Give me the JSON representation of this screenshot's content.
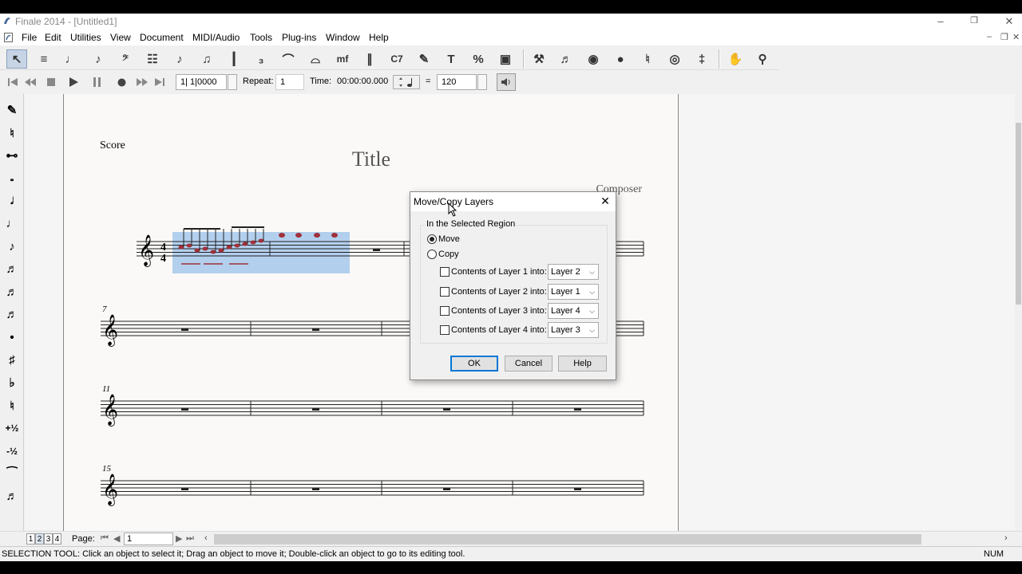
{
  "window": {
    "title": "Finale 2014 - [Untitled1]",
    "minimize": "–",
    "restore": "❐",
    "close": "✕"
  },
  "menu": {
    "items": [
      "File",
      "Edit",
      "Utilities",
      "View",
      "Document",
      "MIDI/Audio",
      "Tools",
      "Plug-ins",
      "Window",
      "Help"
    ],
    "mdi_min": "–",
    "mdi_restore": "❐",
    "mdi_close": "✕"
  },
  "toolbar": {
    "tools": [
      {
        "name": "selection-tool",
        "glyph": "↖"
      },
      {
        "name": "staff-tool",
        "glyph": "≡"
      },
      {
        "name": "simple-entry-tool",
        "glyph": "♩"
      },
      {
        "name": "speedy-entry-tool",
        "glyph": "♪"
      },
      {
        "name": "clef-tool",
        "glyph": "𝄢"
      },
      {
        "name": "key-signature-tool",
        "glyph": "☷"
      },
      {
        "name": "time-signature-tool",
        "glyph": "♪"
      },
      {
        "name": "note-mover-tool",
        "glyph": "♫"
      },
      {
        "name": "measure-tool",
        "glyph": "┃"
      },
      {
        "name": "tuplet-tool",
        "glyph": "₃"
      },
      {
        "name": "smart-shape-tool",
        "glyph": "⌒"
      },
      {
        "name": "articulation-tool",
        "glyph": "⌓"
      },
      {
        "name": "expression-tool",
        "glyph": "mf"
      },
      {
        "name": "repeat-tool",
        "glyph": "∥"
      },
      {
        "name": "chord-tool",
        "glyph": "C7"
      },
      {
        "name": "lyrics-tool",
        "glyph": "✎"
      },
      {
        "name": "text-tool",
        "glyph": "T"
      },
      {
        "name": "resize-tool",
        "glyph": "%"
      },
      {
        "name": "graphics-tool",
        "glyph": "▣"
      },
      {
        "name": "special-tools",
        "glyph": "⚒"
      },
      {
        "name": "midi-tool",
        "glyph": "♬"
      },
      {
        "name": "hyperscribe-tool",
        "glyph": "◉"
      },
      {
        "name": "page-layout-tool",
        "glyph": "●"
      },
      {
        "name": "mirror-tool",
        "glyph": "♮"
      },
      {
        "name": "ossia-tool",
        "glyph": "◎"
      },
      {
        "name": "zoom-tool",
        "glyph": "‡"
      },
      {
        "name": "hand-grabber-tool",
        "glyph": "✋"
      },
      {
        "name": "zoom-magnifier-tool",
        "glyph": "⚲"
      }
    ]
  },
  "playback": {
    "position": "1| 1|0000",
    "repeat_label": "Repeat:",
    "repeat_value": "1",
    "time_label": "Time:",
    "time_value": "00:00:00.000",
    "equals": "=",
    "tempo": "120"
  },
  "palette": {
    "items": [
      "eraser",
      "half-step-icon",
      "tie-icon",
      "whole-note",
      "half-note",
      "quarter-note",
      "eighth-note",
      "sixteenth-note",
      "thirtysecond-note",
      "sixtyfourth-note",
      "dot",
      "sharp",
      "flat",
      "natural",
      "plus-half-step",
      "minus-half-step",
      "tie",
      "tuplet"
    ]
  },
  "score": {
    "label": "Score",
    "title": "Title",
    "composer": "Composer",
    "measure_numbers": [
      "7",
      "11",
      "15"
    ]
  },
  "dialog": {
    "title": "Move/Copy Layers",
    "group_label": "In the Selected Region",
    "move_label": "Move",
    "copy_label": "Copy",
    "rows": [
      {
        "label": "Contents of Layer 1 into:",
        "value": "Layer 2"
      },
      {
        "label": "Contents of Layer 2 into:",
        "value": "Layer 1"
      },
      {
        "label": "Contents of Layer 3 into:",
        "value": "Layer 4"
      },
      {
        "label": "Contents of Layer 4 into:",
        "value": "Layer 3"
      }
    ],
    "ok": "OK",
    "cancel": "Cancel",
    "help": "Help"
  },
  "pagebar": {
    "tabs": [
      "1",
      "2",
      "3",
      "4"
    ],
    "page_label": "Page:",
    "page_value": "1"
  },
  "status": {
    "message": "SELECTION TOOL: Click an object to select it; Drag an object to move it; Double-click an object to go to its editing tool.",
    "num": "NUM"
  },
  "colors": {
    "selection": "#a6c8ec",
    "layer_note": "#a0303a"
  }
}
